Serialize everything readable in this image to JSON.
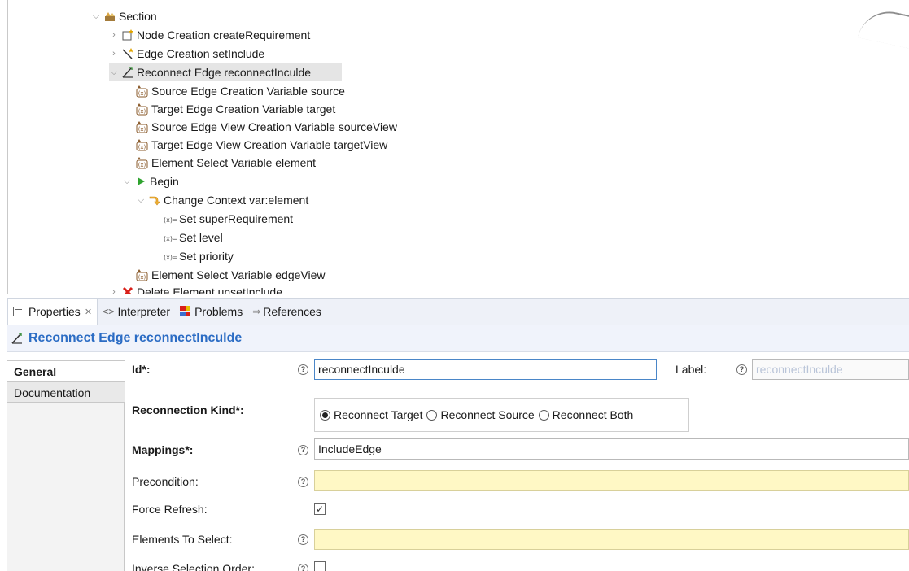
{
  "tree": {
    "items": [
      {
        "label": "Section"
      },
      {
        "label": "Node Creation createRequirement"
      },
      {
        "label": "Edge Creation setInclude"
      },
      {
        "label": "Reconnect Edge reconnectInculde"
      },
      {
        "label": "Source Edge Creation Variable source"
      },
      {
        "label": "Target Edge Creation Variable target"
      },
      {
        "label": "Source Edge View Creation Variable sourceView"
      },
      {
        "label": "Target Edge View Creation Variable targetView"
      },
      {
        "label": "Element Select Variable element"
      },
      {
        "label": "Begin"
      },
      {
        "label": "Change Context var:element"
      },
      {
        "label": "Set superRequirement"
      },
      {
        "label": "Set level"
      },
      {
        "label": "Set priority"
      },
      {
        "label": "Element Select Variable edgeView"
      },
      {
        "label": "Delete Element unsetInclude"
      }
    ]
  },
  "tabs": {
    "properties": "Properties",
    "interpreter": "Interpreter",
    "problems": "Problems",
    "references": "References"
  },
  "header": {
    "title": "Reconnect Edge reconnectInculde"
  },
  "side_tabs": {
    "general": "General",
    "documentation": "Documentation"
  },
  "form": {
    "id_label": "Id*:",
    "id_value": "reconnectInculde",
    "label_label": "Label:",
    "label_value": "reconnectInculde",
    "reconnection_kind_label": "Reconnection Kind*:",
    "reconnect_target": "Reconnect Target",
    "reconnect_source": "Reconnect Source",
    "reconnect_both": "Reconnect Both",
    "reconnection_kind_selected": "Reconnect Target",
    "mappings_label": "Mappings*:",
    "mappings_value": "IncludeEdge",
    "precondition_label": "Precondition:",
    "precondition_value": "",
    "force_refresh_label": "Force Refresh:",
    "force_refresh_checked": true,
    "elements_to_select_label": "Elements To Select:",
    "elements_to_select_value": "",
    "inverse_selection_order_label": "Inverse Selection Order:",
    "inverse_selection_order_checked": false
  },
  "colors": {
    "title_blue": "#2b6cc4",
    "field_yellow": "#fff8c5",
    "begin_green": "#2ea32e",
    "delete_red": "#d9201a"
  }
}
